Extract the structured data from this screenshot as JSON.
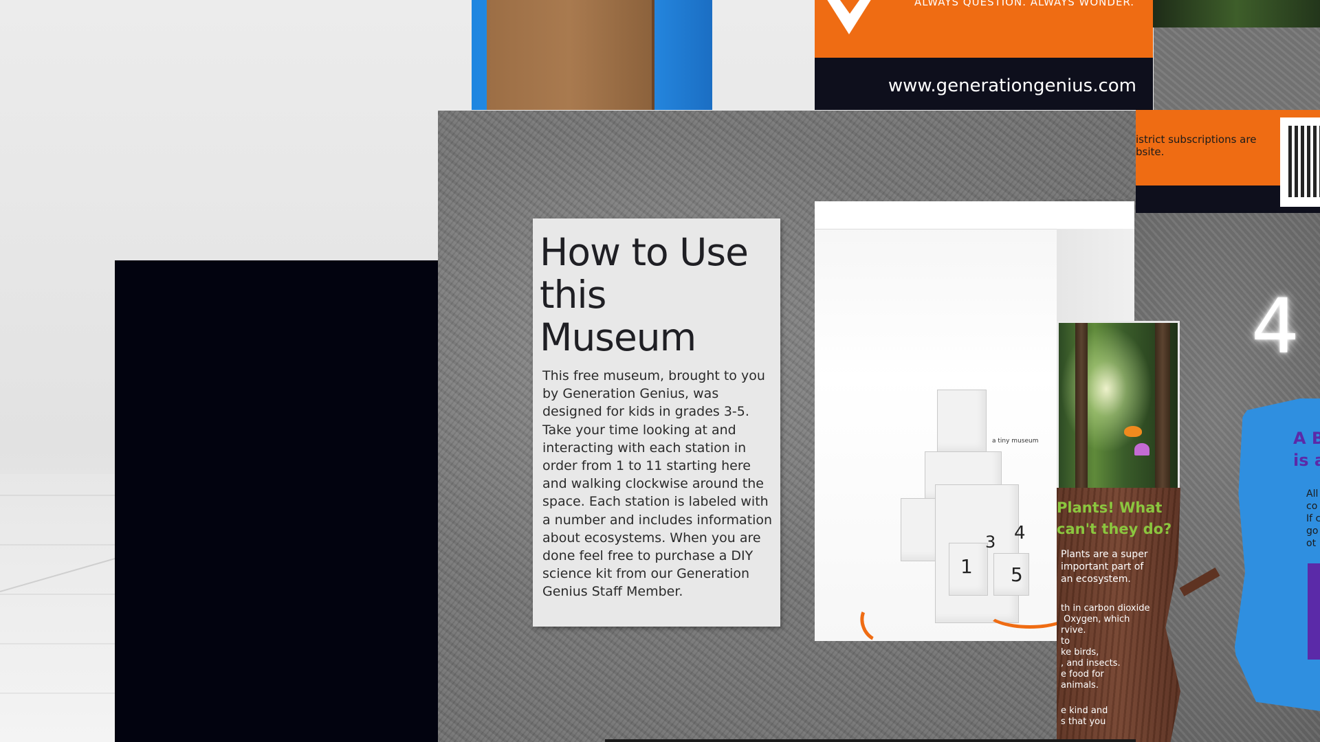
{
  "banner": {
    "motto": "ALWAYS QUESTION. ALWAYS WONDER.",
    "url": "www.generationgenius.com"
  },
  "info_strip": {
    "text": "istrict subscriptions are\nbsite."
  },
  "sign": {
    "title": "How to Use this Museum",
    "body": "This free museum, brought to you by Generation Genius, was designed for kids in grades 3-5. Take your time looking at and interacting with each station in order from 1 to 11 starting here and walking clockwise around the space. Each station is labeled with a number and includes information about ecosystems. When you are done feel free to purchase a DIY science kit from our Generation Genius Staff Member."
  },
  "model": {
    "label": "a tiny museum",
    "numbers": [
      "1",
      "3",
      "4",
      "5"
    ]
  },
  "plants": {
    "title": "Plants! What can't they do?",
    "p1": "Plants are a super important part of an ecosystem.",
    "p2": "th in carbon dioxide\n Oxygen, which\nrvive.\nto\nke birds,\n, and insects.\ne food for\nanimals.",
    "p3": "e kind and\ns that you"
  },
  "station": {
    "number": "4"
  },
  "blue_sign": {
    "title": "A B\nis a",
    "text": "All\nco\nIf c\ngo\not"
  },
  "colors": {
    "orange": "#ef6c13",
    "navy": "#0e0f1c",
    "plant_green": "#8bc63f",
    "blue": "#2f8fe0",
    "purple": "#5b2aa8"
  }
}
